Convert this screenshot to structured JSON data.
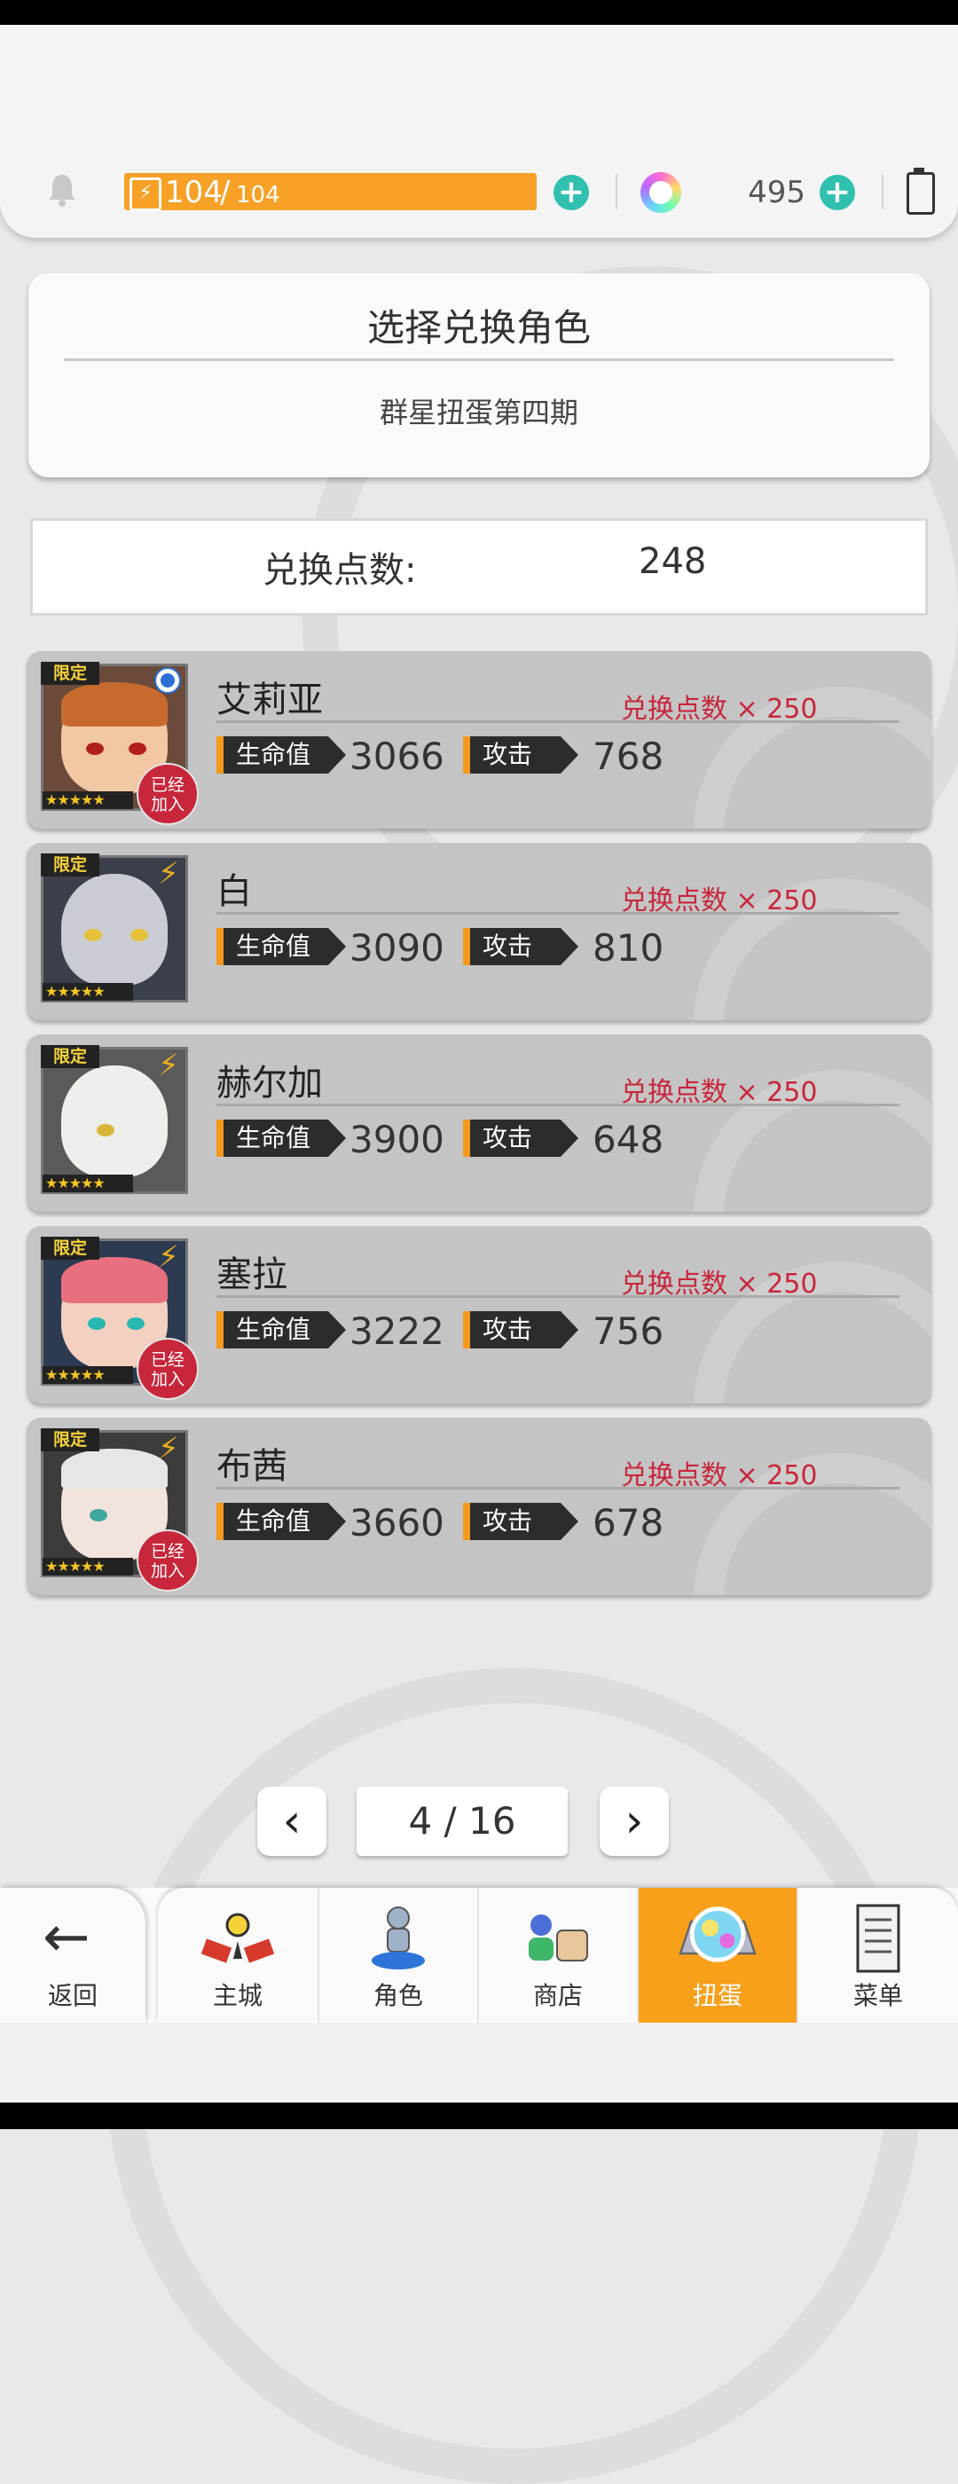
{
  "status": {
    "energy_current": "104",
    "energy_separator": "/",
    "energy_max": "104",
    "gem_count": "495"
  },
  "header": {
    "title": "选择兑换角色",
    "subtitle": "群星扭蛋第四期"
  },
  "points": {
    "label": "兑换点数:",
    "value": "248"
  },
  "characters": [
    {
      "name": "艾莉亚",
      "hp_label": "生命值",
      "hp": "3066",
      "atk_label": "攻击",
      "atk": "768",
      "cost": "兑换点数 × 250",
      "limited": "限定",
      "stars": "★★★★★",
      "joined": "已经\n加入"
    },
    {
      "name": "白",
      "hp_label": "生命值",
      "hp": "3090",
      "atk_label": "攻击",
      "atk": "810",
      "cost": "兑换点数 × 250",
      "limited": "限定",
      "stars": "★★★★★"
    },
    {
      "name": "赫尔加",
      "hp_label": "生命值",
      "hp": "3900",
      "atk_label": "攻击",
      "atk": "648",
      "cost": "兑换点数 × 250",
      "limited": "限定",
      "stars": "★★★★★"
    },
    {
      "name": "塞拉",
      "hp_label": "生命值",
      "hp": "3222",
      "atk_label": "攻击",
      "atk": "756",
      "cost": "兑换点数 × 250",
      "limited": "限定",
      "stars": "★★★★★",
      "joined": "已经\n加入"
    },
    {
      "name": "布茜",
      "hp_label": "生命值",
      "hp": "3660",
      "atk_label": "攻击",
      "atk": "678",
      "cost": "兑换点数 × 250",
      "limited": "限定",
      "stars": "★★★★★",
      "joined": "已经\n加入"
    }
  ],
  "pager": {
    "prev": "‹",
    "next": "›",
    "page": "4 / 16"
  },
  "nav": {
    "back": "返回",
    "tabs": [
      "主城",
      "角色",
      "商店",
      "扭蛋",
      "菜单"
    ],
    "active": "扭蛋"
  },
  "colors": {
    "accent": "#f9a01b",
    "energy": "#f7a126",
    "plus": "#2fc0b0",
    "cost_red": "#c8263a"
  }
}
